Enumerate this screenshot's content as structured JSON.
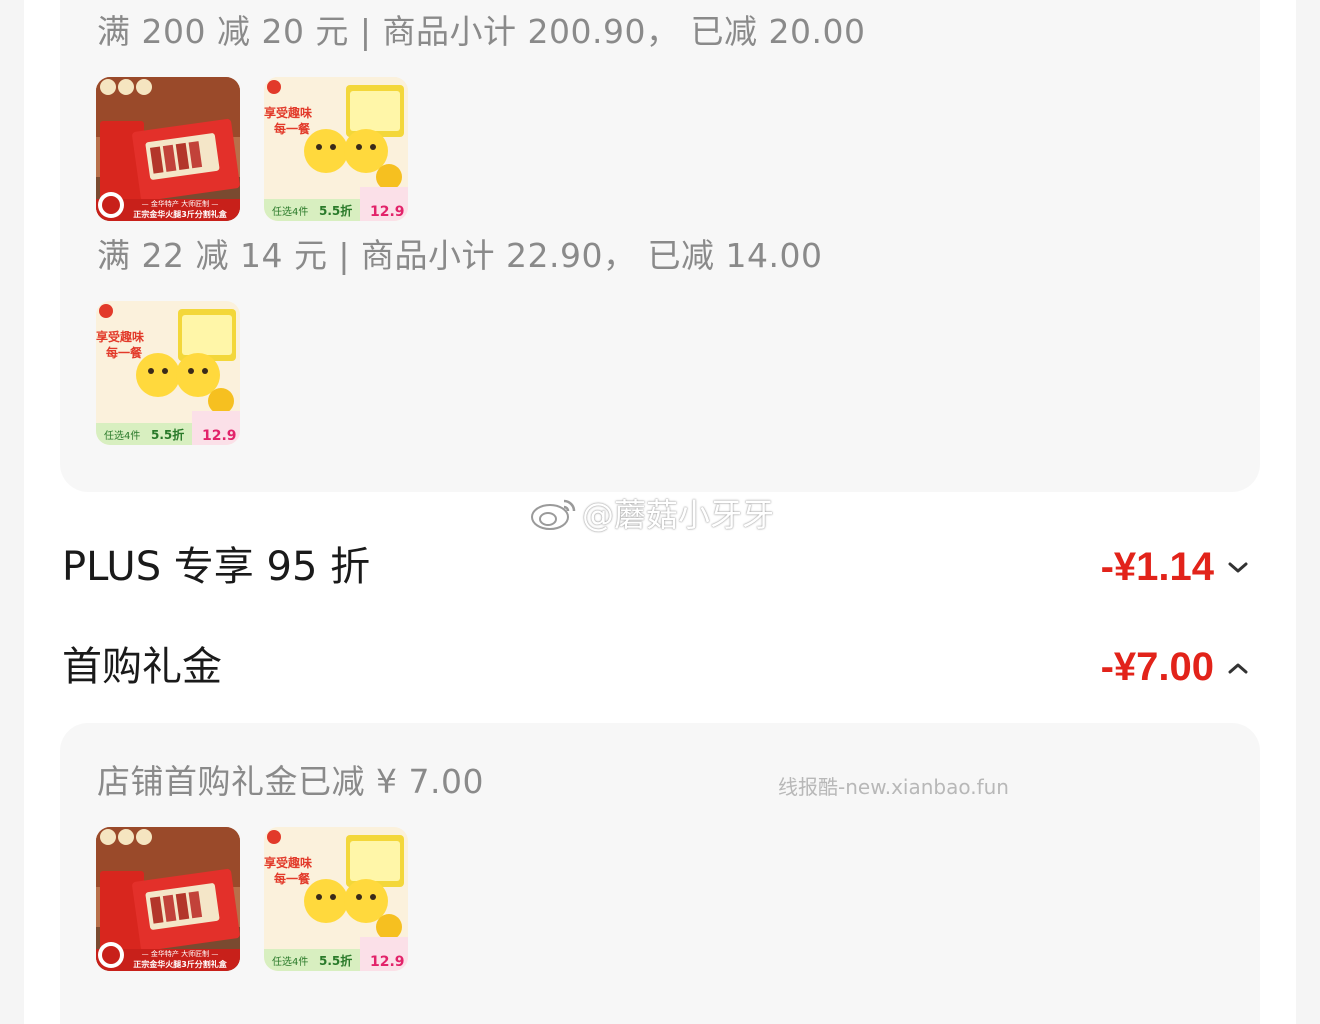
{
  "promotions": [
    {
      "label": "满 200 减 20 元 | 商品小计 200.90， 已减 20.00",
      "products": [
        "ham-gift-box",
        "yogurt-snack-box"
      ]
    },
    {
      "label": "满 22 减 14 元 | 商品小计 22.90， 已减 14.00",
      "products": [
        "yogurt-snack-box"
      ]
    }
  ],
  "plus_discount": {
    "label": "PLUS 专享 95 折",
    "amount": "-¥1.14",
    "chevron": "chevron-down-icon"
  },
  "first_purchase": {
    "label": "首购礼金",
    "amount": "-¥7.00",
    "chevron": "chevron-up-icon",
    "detail": "店铺首购礼金已减 ¥ 7.00",
    "products": [
      "ham-gift-box",
      "yogurt-snack-box"
    ]
  },
  "products": {
    "ham": {
      "banner_text": "正宗金华火腿3斤分割礼盒",
      "top_text": "— 金华特产 大师匠制 —"
    },
    "yogurt": {
      "headline_1": "享受趣味",
      "headline_2": "每一餐",
      "tag_text": "任选4件",
      "discount_text": "5.5折",
      "price_text": "12.9"
    }
  },
  "watermarks": {
    "weibo": "@蘑菇小牙牙",
    "site": "线报酷-new.xianbao.fun"
  },
  "colors": {
    "discount_red": "#e2231a",
    "panel_bg": "#f7f7f7",
    "muted_text": "#8a8a8a"
  }
}
